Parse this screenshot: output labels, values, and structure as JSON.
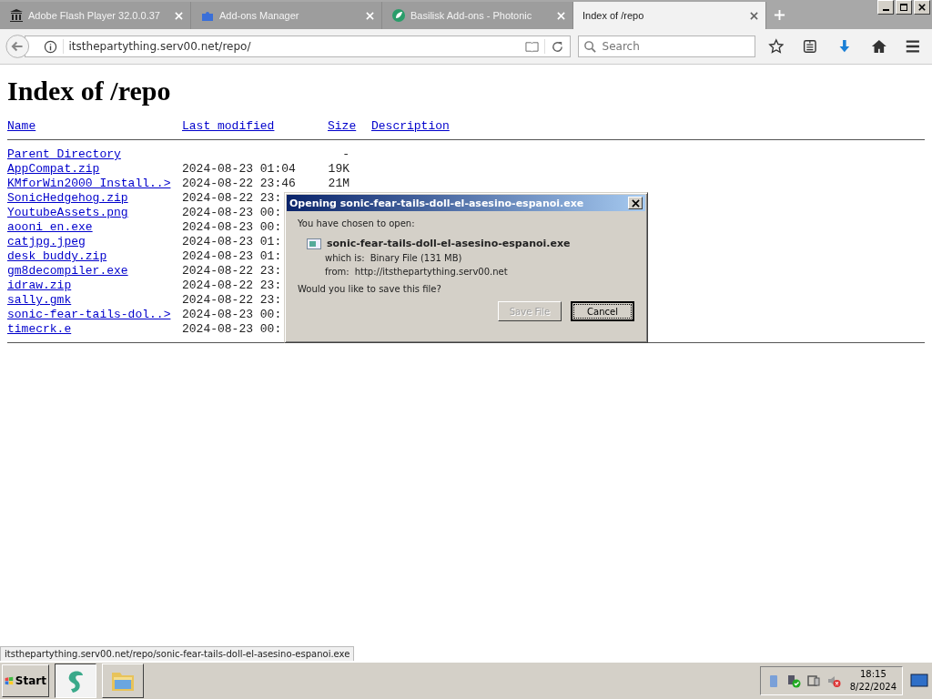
{
  "tabs": [
    {
      "title": "Adobe Flash Player 32.0.0.37",
      "selected": false
    },
    {
      "title": "Add-ons Manager",
      "selected": false
    },
    {
      "title": "Basilisk Add-ons - Photonic",
      "selected": false
    },
    {
      "title": "Index of /repo",
      "selected": true
    }
  ],
  "url": "itsthepartything.serv00.net/repo/",
  "search": {
    "placeholder": "Search"
  },
  "page": {
    "heading": "Index of /repo",
    "columns": [
      "Name",
      "Last modified",
      "Size",
      "Description"
    ],
    "rows": [
      {
        "name": "Parent Directory",
        "size": "-"
      },
      {
        "name": "AppCompat.zip",
        "date": "2024-08-23 01:04",
        "size": "19K"
      },
      {
        "name": "KMforWin2000 Install..>",
        "date": "2024-08-22 23:46",
        "size": "21M"
      },
      {
        "name": "SonicHedgehog.zip",
        "date": "2024-08-22 23:"
      },
      {
        "name": "YoutubeAssets.png",
        "date": "2024-08-23 00:"
      },
      {
        "name": "aooni en.exe",
        "date": "2024-08-23 00:"
      },
      {
        "name": "catjpg.jpeg",
        "date": "2024-08-23 01:"
      },
      {
        "name": "desk buddy.zip",
        "date": "2024-08-23 01:"
      },
      {
        "name": "gm8decompiler.exe",
        "date": "2024-08-22 23:"
      },
      {
        "name": "idraw.zip",
        "date": "2024-08-22 23:"
      },
      {
        "name": "sally.gmk",
        "date": "2024-08-22 23:"
      },
      {
        "name": "sonic-fear-tails-dol..>",
        "date": "2024-08-23 00:"
      },
      {
        "name": "timecrk.e",
        "date": "2024-08-23 00:"
      }
    ]
  },
  "dialog": {
    "title": "Opening sonic-fear-tails-doll-el-asesino-espanoi.exe",
    "intro": "You have chosen to open:",
    "file": "sonic-fear-tails-doll-el-asesino-espanoi.exe",
    "which_label": "which is:",
    "which": "Binary File (131 MB)",
    "from_label": "from:",
    "from": "http://itsthepartything.serv00.net",
    "question": "Would you like to save this file?",
    "buttons": [
      {
        "label": "Save File",
        "disabled": true,
        "focused": false
      },
      {
        "label": "Cancel",
        "disabled": false,
        "focused": true
      }
    ]
  },
  "status_link": "itsthepartything.serv00.net/repo/sonic-fear-tails-doll-el-asesino-espanoi.exe",
  "taskbar": {
    "start": "Start",
    "tasks": [
      {
        "selected": true
      },
      {
        "selected": false
      }
    ],
    "time": "18:15",
    "date": "8/22/2024"
  }
}
